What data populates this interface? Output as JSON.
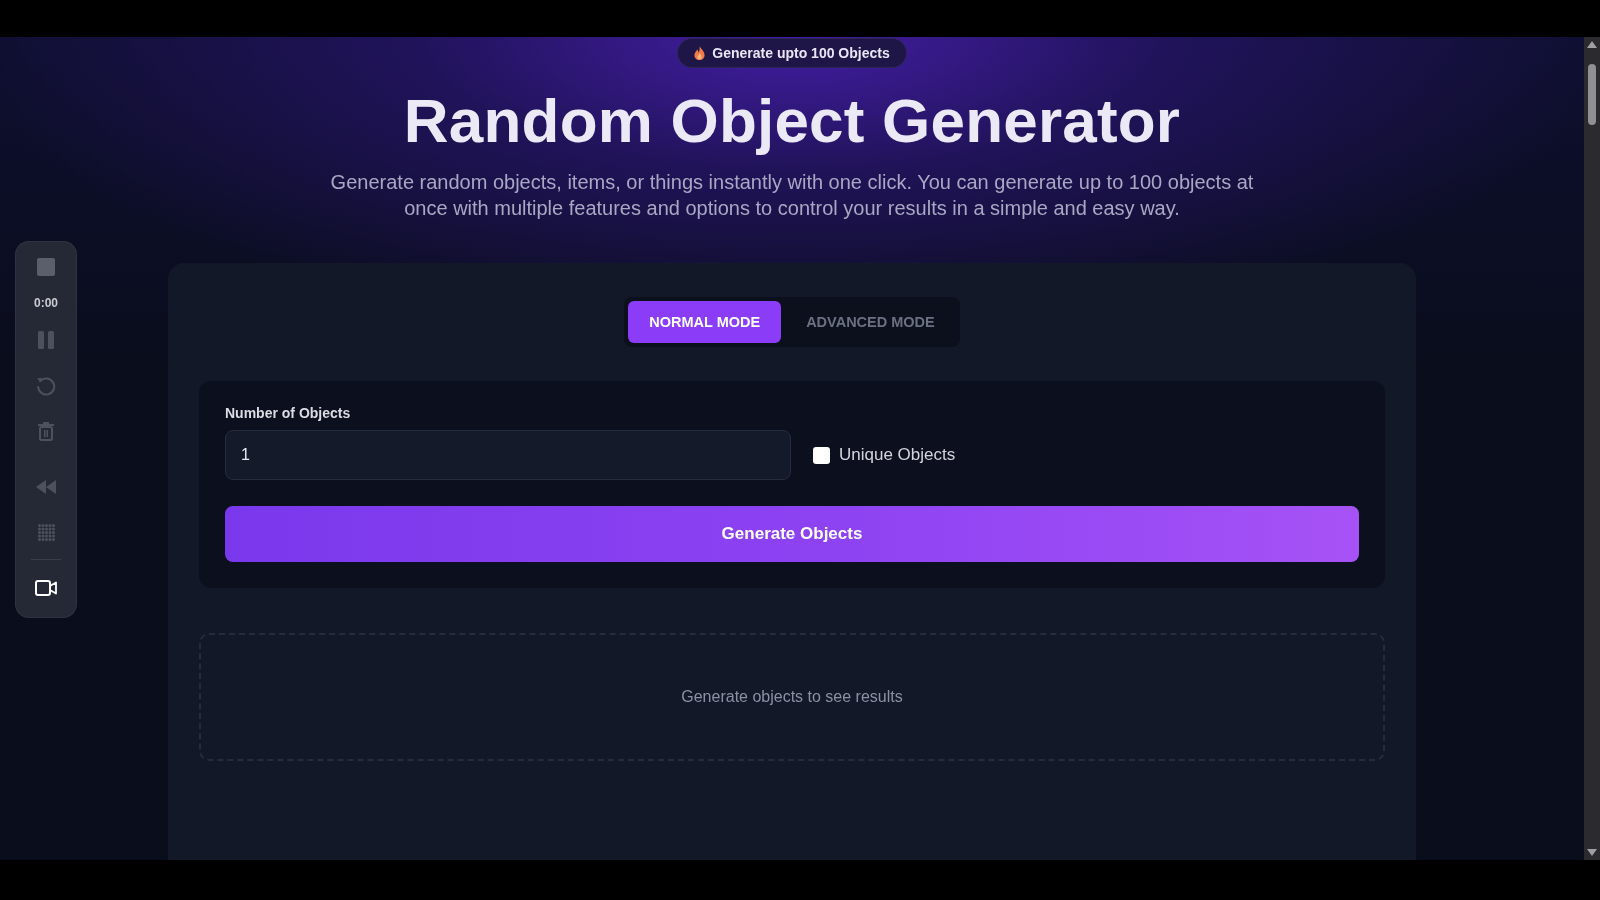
{
  "top_badge": {
    "text": "Generate upto 100 Objects"
  },
  "title": "Random Object Generator",
  "description": "Generate random objects, items, or things instantly with one click. You can generate up to 100 objects at once with multiple features and options to control your results in a simple and easy way.",
  "mode_tabs": [
    {
      "label": "NORMAL MODE",
      "selected": true
    },
    {
      "label": "ADVANCED MODE",
      "selected": false
    }
  ],
  "form": {
    "count_label": "Number of Objects",
    "count_value": "1",
    "unique_checkbox": {
      "label": "Unique Objects",
      "checked": false
    },
    "generate_button": "Generate Objects"
  },
  "results": {
    "empty_message": "Generate objects to see results"
  },
  "recorder_toolbar": {
    "time": "0:00"
  }
}
